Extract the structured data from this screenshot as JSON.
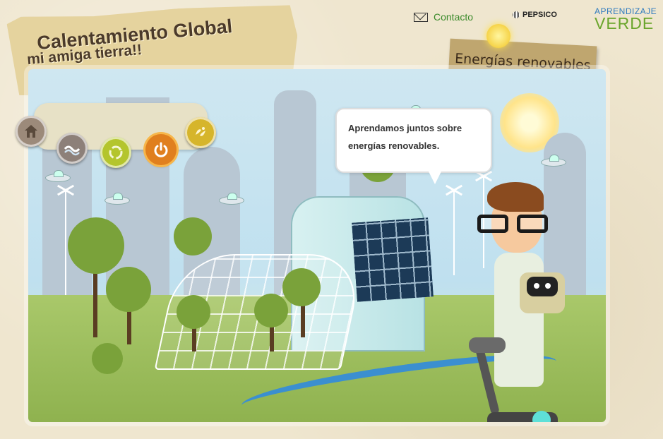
{
  "header": {
    "contact_label": "Contacto",
    "pepsico_label": "PEPSICO",
    "brand_line1": "APRENDIZAJE",
    "brand_line2": "VERDE"
  },
  "title": {
    "line1": "Calentamiento Global",
    "line2": "mi amiga tierra!!"
  },
  "section": {
    "label": "Energías renovables"
  },
  "speech_bubble": {
    "text": "Aprendamos juntos sobre energías renovables."
  },
  "nav": {
    "buttons": [
      {
        "icon": "home-icon"
      },
      {
        "icon": "water-icon"
      },
      {
        "icon": "recycle-icon"
      },
      {
        "icon": "power-icon",
        "active": true
      },
      {
        "icon": "biodiversity-icon"
      }
    ]
  },
  "colors": {
    "accent_green": "#3a8a2a",
    "brand_blue": "#2f7bbf",
    "brand_green": "#6aa52c",
    "active_button": "#e07f1e"
  }
}
